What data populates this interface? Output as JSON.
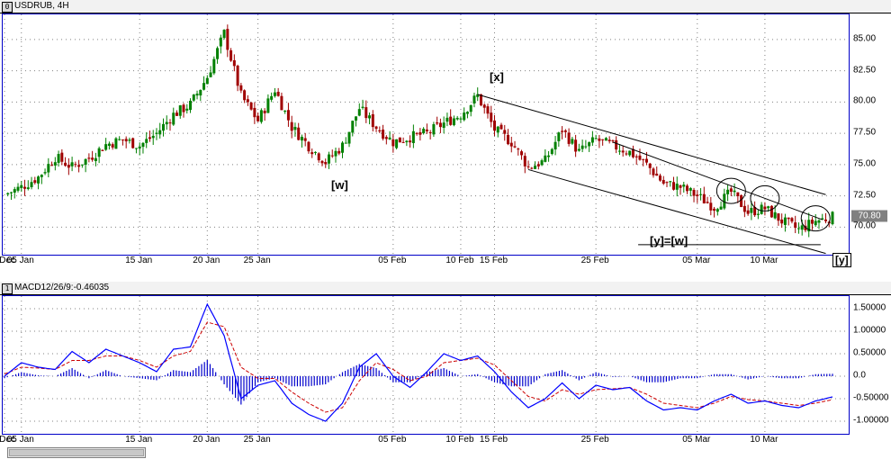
{
  "main_pane": {
    "button_glyph": "0",
    "title": "USDRUB, 4H",
    "last_price_label": "70.80"
  },
  "macd_pane": {
    "button_glyph": "1",
    "title": "MACD12/26/9:-0.46035"
  },
  "colors": {
    "up_candle": "#008000",
    "down_candle": "#a00000",
    "macd_line": "#0000ff",
    "signal_line": "#cc0000",
    "histogram": "#0000cc",
    "grid": "#808080",
    "channel": "#000000"
  },
  "annotations": {
    "w": "[w]",
    "x": "[x]",
    "y_eq_w": "[y]=[w]",
    "y": "[y]"
  },
  "chart_data": [
    {
      "type": "candlestick",
      "title": "USDRUB, 4H",
      "x_tick_labels": [
        "0 Dec",
        "05 Jan",
        "15 Jan",
        "20 Jan",
        "25 Jan",
        "05 Feb",
        "10 Feb",
        "15 Feb",
        "25 Feb",
        "05 Mar",
        "10 Mar"
      ],
      "y_tick_labels": [
        "85.00",
        "82.50",
        "80.00",
        "77.50",
        "75.00",
        "72.50",
        "70.00"
      ],
      "ylim": [
        67.8,
        87.0
      ],
      "grid": true,
      "last_price": 70.8,
      "close_path": [
        [
          "0 Dec",
          72.6
        ],
        [
          "05 Jan",
          73.2
        ],
        [
          "",
          74.0
        ],
        [
          "",
          75.6
        ],
        [
          "",
          74.8
        ],
        [
          "",
          75.5
        ],
        [
          "",
          76.6
        ],
        [
          "",
          77.0
        ],
        [
          "15 Jan",
          76.5
        ],
        [
          "",
          77.5
        ],
        [
          "",
          79.0
        ],
        [
          "",
          79.8
        ],
        [
          "20 Jan",
          82.0
        ],
        [
          "",
          85.5
        ],
        [
          "",
          80.5
        ],
        [
          "25 Jan",
          78.5
        ],
        [
          "",
          81.0
        ],
        [
          "",
          78.0
        ],
        [
          "",
          76.5
        ],
        [
          "",
          75.2
        ],
        [
          "",
          76.5
        ],
        [
          "",
          79.5
        ],
        [
          "",
          78.0
        ],
        [
          "05 Feb",
          76.8
        ],
        [
          "",
          77.2
        ],
        [
          "",
          77.5
        ],
        [
          "",
          78.3
        ],
        [
          "10 Feb",
          79.0
        ],
        [
          "",
          80.5
        ],
        [
          "15 Feb",
          77.8
        ],
        [
          "",
          76.8
        ],
        [
          "",
          74.8
        ],
        [
          "",
          75.3
        ],
        [
          "",
          77.8
        ],
        [
          "",
          76.0
        ],
        [
          "25 Feb",
          77.0
        ],
        [
          "",
          76.5
        ],
        [
          "",
          76.0
        ],
        [
          "",
          75.0
        ],
        [
          "",
          73.5
        ],
        [
          "",
          73.2
        ],
        [
          "05 Mar",
          72.5
        ],
        [
          "",
          71.6
        ],
        [
          "",
          72.8
        ],
        [
          "",
          71.2
        ],
        [
          "10 Mar",
          71.5
        ],
        [
          "",
          70.5
        ],
        [
          "",
          69.8
        ],
        [
          "",
          70.5
        ],
        [
          "",
          70.8
        ]
      ],
      "annotations": [
        "[w]",
        "[x]",
        "[y]=[w]",
        "[y]"
      ]
    },
    {
      "type": "line",
      "title": "MACD12/26/9:-0.46035",
      "y_tick_labels": [
        "1.50000",
        "1.00000",
        "0.50000",
        "0.0",
        "-0.50000",
        "-1.00000"
      ],
      "ylim": [
        -1.28,
        1.78
      ],
      "grid": true,
      "current_value": -0.46035,
      "macd": [
        [
          "0 Dec",
          0.0
        ],
        [
          "",
          0.3
        ],
        [
          "05 Jan",
          0.2
        ],
        [
          "",
          0.15
        ],
        [
          "",
          0.55
        ],
        [
          "",
          0.3
        ],
        [
          "",
          0.6
        ],
        [
          "",
          0.45
        ],
        [
          "15 Jan",
          0.3
        ],
        [
          "",
          0.1
        ],
        [
          "",
          0.6
        ],
        [
          "",
          0.65
        ],
        [
          "20 Jan",
          1.6
        ],
        [
          "",
          0.9
        ],
        [
          "",
          -0.5
        ],
        [
          "25 Jan",
          -0.2
        ],
        [
          "",
          -0.1
        ],
        [
          "",
          -0.6
        ],
        [
          "",
          -0.85
        ],
        [
          "",
          -1.0
        ],
        [
          "",
          -0.6
        ],
        [
          "",
          0.2
        ],
        [
          "",
          0.5
        ],
        [
          "05 Feb",
          0.0
        ],
        [
          "",
          -0.25
        ],
        [
          "",
          0.1
        ],
        [
          "",
          0.5
        ],
        [
          "10 Feb",
          0.35
        ],
        [
          "",
          0.45
        ],
        [
          "15 Feb",
          0.1
        ],
        [
          "",
          -0.35
        ],
        [
          "",
          -0.7
        ],
        [
          "",
          -0.5
        ],
        [
          "",
          -0.15
        ],
        [
          "",
          -0.5
        ],
        [
          "25 Feb",
          -0.2
        ],
        [
          "",
          -0.3
        ],
        [
          "",
          -0.25
        ],
        [
          "",
          -0.55
        ],
        [
          "",
          -0.75
        ],
        [
          "",
          -0.7
        ],
        [
          "05 Mar",
          -0.75
        ],
        [
          "",
          -0.55
        ],
        [
          "",
          -0.4
        ],
        [
          "",
          -0.6
        ],
        [
          "10 Mar",
          -0.55
        ],
        [
          "",
          -0.65
        ],
        [
          "",
          -0.7
        ],
        [
          "",
          -0.55
        ],
        [
          "",
          -0.46
        ]
      ],
      "signal": [
        [
          "0 Dec",
          0.05
        ],
        [
          "",
          0.2
        ],
        [
          "05 Jan",
          0.18
        ],
        [
          "",
          0.15
        ],
        [
          "",
          0.35
        ],
        [
          "",
          0.35
        ],
        [
          "",
          0.45
        ],
        [
          "",
          0.45
        ],
        [
          "15 Jan",
          0.35
        ],
        [
          "",
          0.2
        ],
        [
          "",
          0.45
        ],
        [
          "",
          0.55
        ],
        [
          "20 Jan",
          1.2
        ],
        [
          "",
          1.1
        ],
        [
          "",
          0.2
        ],
        [
          "25 Jan",
          -0.05
        ],
        [
          "",
          -0.05
        ],
        [
          "",
          -0.35
        ],
        [
          "",
          -0.6
        ],
        [
          "",
          -0.8
        ],
        [
          "",
          -0.7
        ],
        [
          "",
          -0.1
        ],
        [
          "",
          0.3
        ],
        [
          "05 Feb",
          0.15
        ],
        [
          "",
          -0.1
        ],
        [
          "",
          0.0
        ],
        [
          "",
          0.3
        ],
        [
          "10 Feb",
          0.35
        ],
        [
          "",
          0.4
        ],
        [
          "15 Feb",
          0.25
        ],
        [
          "",
          -0.1
        ],
        [
          "",
          -0.45
        ],
        [
          "",
          -0.55
        ],
        [
          "",
          -0.3
        ],
        [
          "",
          -0.4
        ],
        [
          "25 Feb",
          -0.3
        ],
        [
          "",
          -0.28
        ],
        [
          "",
          -0.25
        ],
        [
          "",
          -0.4
        ],
        [
          "",
          -0.6
        ],
        [
          "",
          -0.65
        ],
        [
          "05 Mar",
          -0.7
        ],
        [
          "",
          -0.6
        ],
        [
          "",
          -0.45
        ],
        [
          "",
          -0.52
        ],
        [
          "10 Mar",
          -0.55
        ],
        [
          "",
          -0.6
        ],
        [
          "",
          -0.65
        ],
        [
          "",
          -0.6
        ],
        [
          "",
          -0.52
        ]
      ]
    }
  ]
}
